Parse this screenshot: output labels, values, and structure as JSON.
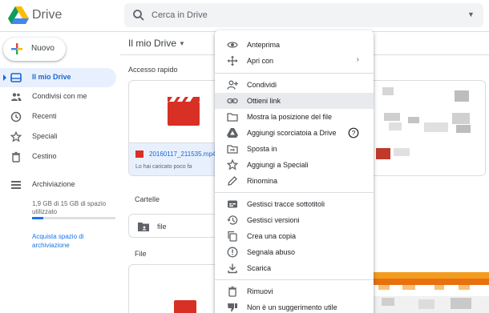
{
  "app": {
    "name": "Drive"
  },
  "search": {
    "placeholder": "Cerca in Drive"
  },
  "new_button": {
    "label": "Nuovo"
  },
  "sidebar": {
    "items": [
      {
        "label": "Il mio Drive",
        "icon": "drive-icon",
        "active": true
      },
      {
        "label": "Condivisi con me",
        "icon": "people-icon"
      },
      {
        "label": "Recenti",
        "icon": "clock-icon"
      },
      {
        "label": "Speciali",
        "icon": "star-icon"
      },
      {
        "label": "Cestino",
        "icon": "trash-icon"
      },
      {
        "label": "Archiviazione",
        "icon": "storage-icon"
      }
    ],
    "storage": {
      "text": "1,9 GB di 15 GB di spazio utilizzato",
      "used_fraction": 0.13,
      "buy_label": "Acquista spazio di archiviazione"
    }
  },
  "main": {
    "breadcrumb": "Il mio Drive",
    "quick_access_label": "Accesso rapido",
    "quick_card": {
      "file_name": "20160117_211535.mp4",
      "subtitle": "Lo hai caricato poco fa"
    },
    "folders_label": "Cartelle",
    "folder_name": "file",
    "files_label": "File"
  },
  "context_menu": {
    "items": [
      {
        "label": "Anteprima",
        "icon": "eye-icon"
      },
      {
        "label": "Apri con",
        "icon": "move-arrows-icon",
        "submenu": true
      },
      {
        "label": "Condividi",
        "icon": "person-add-icon"
      },
      {
        "label": "Ottieni link",
        "icon": "link-icon",
        "highlighted": true
      },
      {
        "label": "Mostra la posizione del file",
        "icon": "folder-outline-icon"
      },
      {
        "label": "Aggiungi scorciatoia a Drive",
        "icon": "drive-shortcut-icon",
        "help": true
      },
      {
        "label": "Sposta in",
        "icon": "move-to-folder-icon"
      },
      {
        "label": "Aggiungi a Speciali",
        "icon": "star-outline-icon"
      },
      {
        "label": "Rinomina",
        "icon": "pencil-icon"
      },
      {
        "label": "Gestisci tracce sottotitoli",
        "icon": "subtitles-icon"
      },
      {
        "label": "Gestisci versioni",
        "icon": "history-icon"
      },
      {
        "label": "Crea una copia",
        "icon": "copy-icon"
      },
      {
        "label": "Segnala abuso",
        "icon": "report-icon"
      },
      {
        "label": "Scarica",
        "icon": "download-icon"
      },
      {
        "label": "Rimuovi",
        "icon": "trash-outline-icon"
      },
      {
        "label": "Non è un suggerimento utile",
        "icon": "thumb-down-icon"
      }
    ],
    "submenu_glyph": "›",
    "help_glyph": "?"
  },
  "colors": {
    "accent": "#1a73e8",
    "active_bg": "#e8f0fe",
    "video_red": "#d93025",
    "highlight": "#e8eaed"
  }
}
